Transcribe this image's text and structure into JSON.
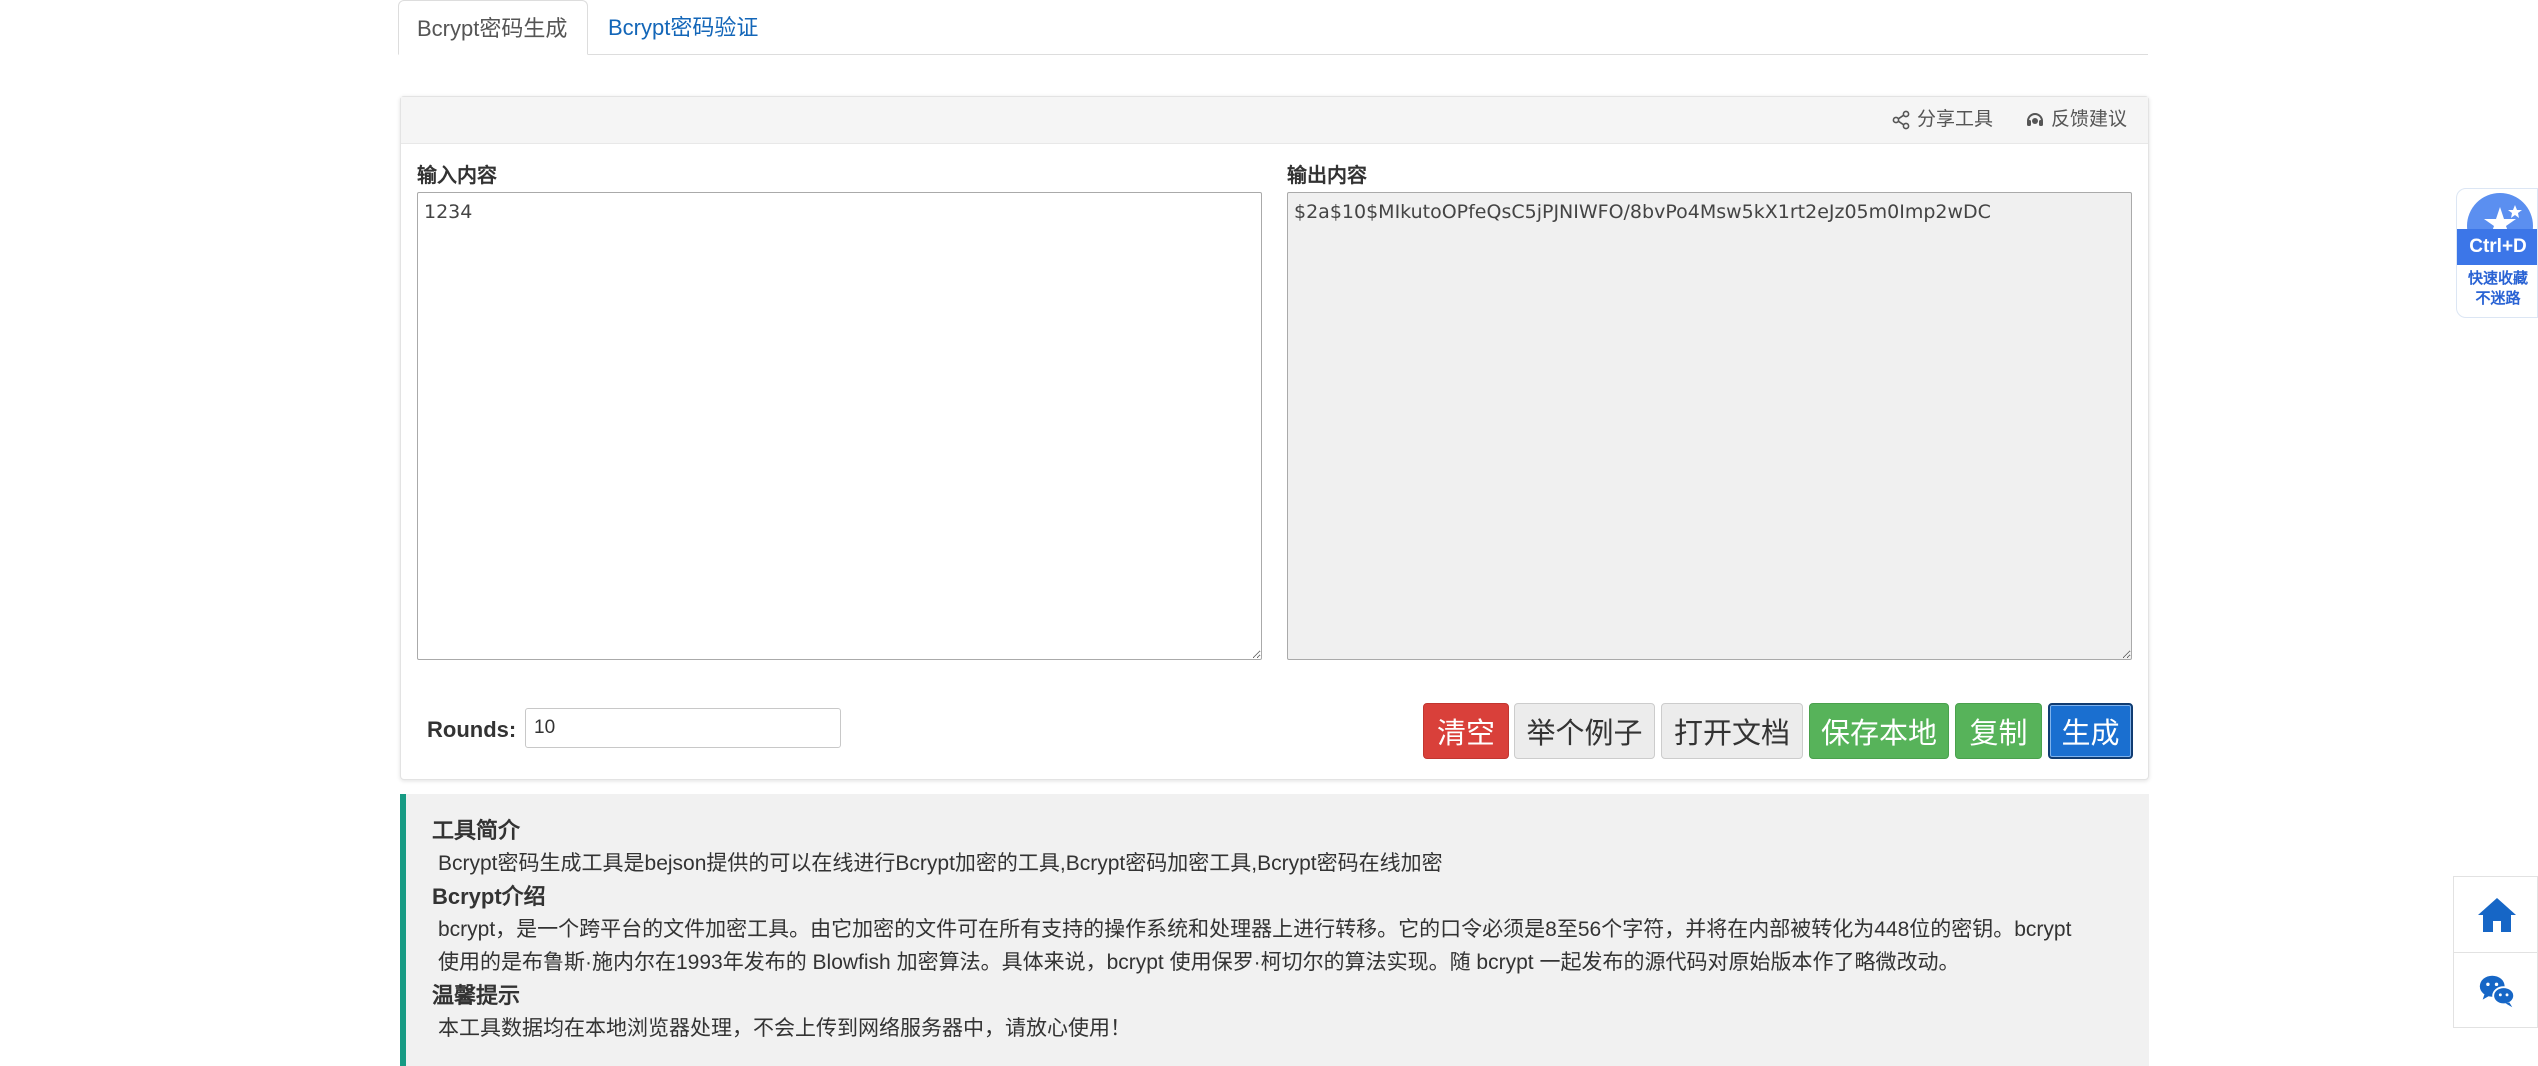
{
  "tabs": [
    {
      "label": "Bcrypt密码生成",
      "active": true
    },
    {
      "label": "Bcrypt密码验证",
      "active": false
    }
  ],
  "panel": {
    "share_label": "分享工具",
    "feedback_label": "反馈建议",
    "input_label": "输入内容",
    "output_label": "输出内容",
    "input_value": "1234",
    "output_value": "$2a$10$MIkutoOPfeQsC5jPJNIWFO/8bvPo4Msw5kX1rt2eJz05m0Imp2wDC",
    "rounds_label": "Rounds:",
    "rounds_value": "10",
    "buttons": {
      "clear": "清空",
      "example": "举个例子",
      "open_doc": "打开文档",
      "save_local": "保存本地",
      "copy": "复制",
      "generate": "生成"
    }
  },
  "info": {
    "intro_title": "工具简介",
    "intro_text": "Bcrypt密码生成工具是bejson提供的可以在线进行Bcrypt加密的工具,Bcrypt密码加密工具,Bcrypt密码在线加密",
    "bcrypt_title": "Bcrypt介绍",
    "bcrypt_text_1": "bcrypt，是一个跨平台的文件加密工具。由它加密的文件可在所有支持的操作系统和处理器上进行转移。它的口令必须是8至56个字符，并将在内部被转化为448位的密钥。bcrypt",
    "bcrypt_text_2": "使用的是布鲁斯·施内尔在1993年发布的 Blowfish 加密算法。具体来说，bcrypt 使用保罗·柯切尔的算法实现。随 bcrypt 一起发布的源代码对原始版本作了略微改动。",
    "tip_title": "温馨提示",
    "tip_text": "本工具数据均在本地浏览器处理，不会上传到网络服务器中，请放心使用！"
  },
  "bookmark": {
    "shortcut": "Ctrl+D",
    "line1": "快速收藏",
    "line2": "不迷路"
  },
  "colors": {
    "accent_blue": "#1a6fd0",
    "danger_red": "#d9403a",
    "success_green": "#57b35a",
    "info_border": "#179b84",
    "tab_link": "#1366b8"
  }
}
